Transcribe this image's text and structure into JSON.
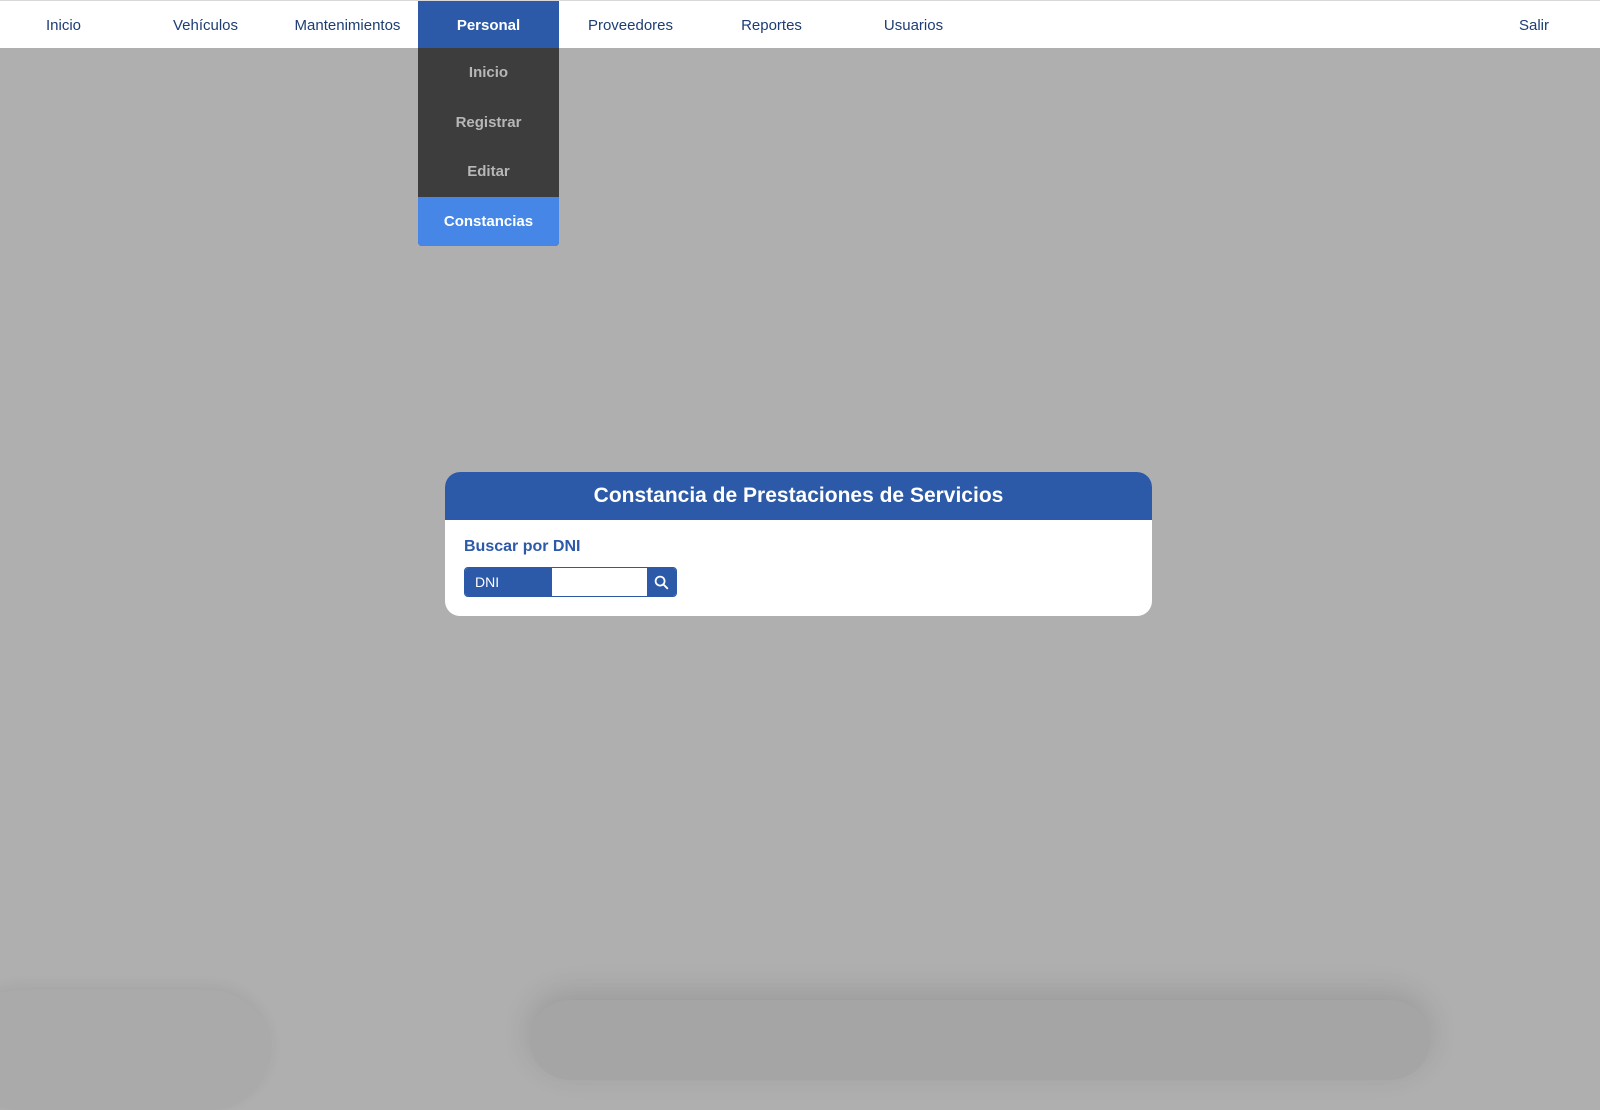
{
  "nav": {
    "items": [
      {
        "label": "Inicio"
      },
      {
        "label": "Vehículos"
      },
      {
        "label": "Mantenimientos"
      },
      {
        "label": "Personal"
      },
      {
        "label": "Proveedores"
      },
      {
        "label": "Reportes"
      },
      {
        "label": "Usuarios"
      }
    ],
    "active": "Personal",
    "exit_label": "Salir"
  },
  "dropdown": {
    "items": [
      {
        "label": "Inicio"
      },
      {
        "label": "Registrar"
      },
      {
        "label": "Editar"
      },
      {
        "label": "Constancias"
      }
    ],
    "selected": "Constancias"
  },
  "card": {
    "title": "Constancia de Prestaciones de Servicios",
    "search_label": "Buscar por DNI",
    "dni_addon": "DNI",
    "dni_value": "",
    "search_icon": "search-icon"
  },
  "colors": {
    "primary": "#2c5aa8",
    "selected": "#4586e6",
    "dropdown_bg": "#3d3d3d",
    "backdrop": "#afafaf"
  }
}
